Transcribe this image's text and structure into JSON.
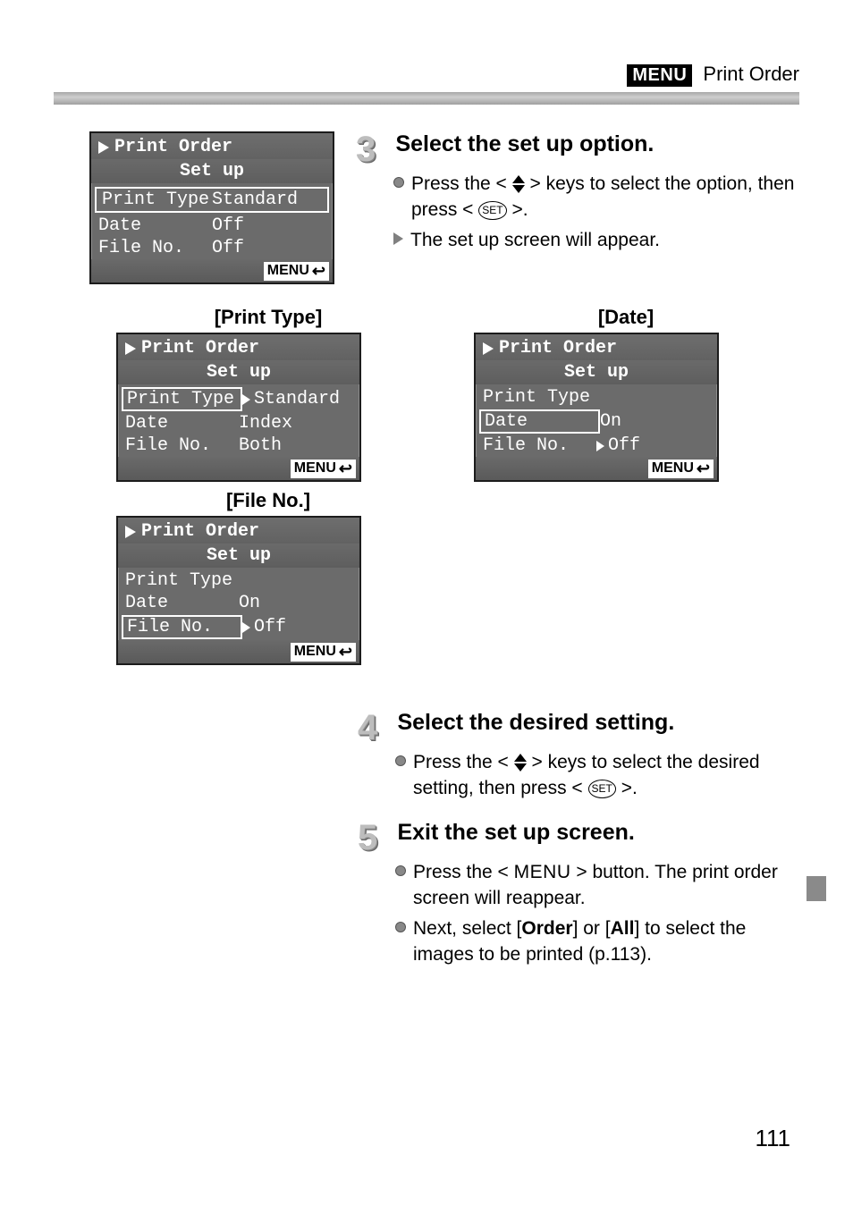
{
  "header": {
    "badge": "MENU",
    "title": "Print Order"
  },
  "lcd_main": {
    "title": "Print Order",
    "subtitle": "Set up",
    "rows": [
      {
        "label": "Print Type",
        "value": "Standard"
      },
      {
        "label": "Date",
        "value": "Off"
      },
      {
        "label": "File No.",
        "value": "Off"
      }
    ],
    "footer": "MENU"
  },
  "step3": {
    "num": "3",
    "title": "Select the set up option.",
    "line1a": "Press the <",
    "line1b": "> keys to select the option, then press <",
    "line1_set": "SET",
    "line1c": ">.",
    "line2": "The set up screen will appear."
  },
  "mid": {
    "col1_head": "[Print Type]",
    "col2_head": "[Date]",
    "col3_head": "[File No.]",
    "print_type": {
      "title": "Print Order",
      "subtitle": "Set up",
      "r1_label": "Print Type",
      "r1_value": "Standard",
      "r2_label": "Date",
      "r2_value": "Index",
      "r3_label": "File No.",
      "r3_value": "Both",
      "footer": "MENU"
    },
    "date_box": {
      "title": "Print Order",
      "subtitle": "Set up",
      "r1_label": "Print Type",
      "r2_label": "Date",
      "r2_value": "On",
      "r3_label": "File No.",
      "r3_value": "Off",
      "footer": "MENU"
    },
    "file_box": {
      "title": "Print Order",
      "subtitle": "Set up",
      "r1_label": "Print Type",
      "r2_label": "Date",
      "r2_value": "On",
      "r3_label": "File No.",
      "r3_value": "Off",
      "footer": "MENU"
    }
  },
  "step4": {
    "num": "4",
    "title": "Select the desired setting.",
    "line1a": "Press the <",
    "line1b": "> keys to select the desired setting, then press <",
    "line1_set": "SET",
    "line1c": ">."
  },
  "step5": {
    "num": "5",
    "title": "Exit the set up screen.",
    "line1a": "Press the <",
    "line1_menu": "MENU",
    "line1b": "> button. The print order screen will reappear.",
    "line2a": "Next, select [",
    "line2_order": "Order",
    "line2b": "] or [",
    "line2_all": "All",
    "line2c": "] to select the images to be printed (p.113)."
  },
  "page_number": "111"
}
